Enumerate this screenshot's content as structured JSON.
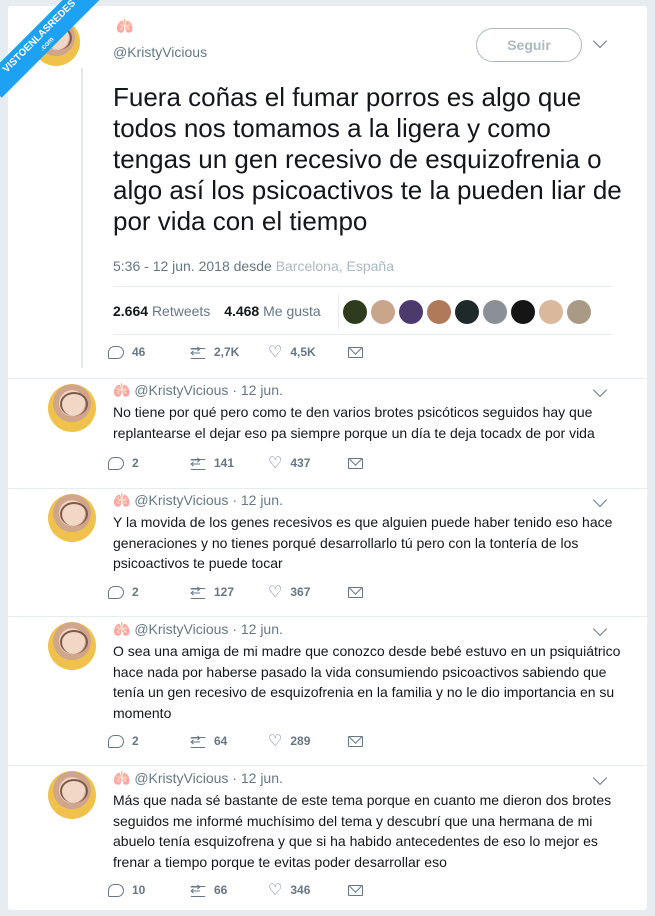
{
  "watermark": {
    "line1": "VISTOENLASREDES",
    "line2": ".com"
  },
  "main_tweet": {
    "handle": "@KristyVicious",
    "emoji": "🫁",
    "follow_label": "Seguir",
    "text": "Fuera coñas el fumar porros es algo que todos nos tomamos a la ligera y como tengas un gen recesivo de esquizofrenia o algo así los psicoactivos te la pueden liar de por vida con el tiempo",
    "time": "5:36 - 12 jun. 2018 desde ",
    "location": "Barcelona, España",
    "retweets_count": "2.664",
    "retweets_label": "Retweets",
    "likes_count": "4.468",
    "likes_label": "Me gusta",
    "replies": "46",
    "rts": "2,7K",
    "favs": "4,5K"
  },
  "replies": [
    {
      "handle": "@KristyVicious",
      "date": "· 12 jun.",
      "text": "No tiene por qué pero como te den varios brotes psicóticos seguidos hay que replantearse el dejar eso pa siempre porque un día te deja tocadx de por vida",
      "replies": "2",
      "rts": "141",
      "favs": "437"
    },
    {
      "handle": "@KristyVicious",
      "date": "· 12 jun.",
      "text": "Y la movida de los genes recesivos es que alguien puede haber tenido eso hace generaciones y no tienes porqué desarrollarlo tú pero con la tontería de los psicoactivos te puede tocar",
      "replies": "2",
      "rts": "127",
      "favs": "367"
    },
    {
      "handle": "@KristyVicious",
      "date": "· 12 jun.",
      "text": "O sea una amiga de mi madre que conozco desde bebé estuvo en un psiquiátrico hace nada por haberse pasado la vida consumiendo psicoactivos sabiendo que tenía un gen recesivo de esquizofrenia en la familia y no le dio importancia en su momento",
      "replies": "2",
      "rts": "64",
      "favs": "289"
    },
    {
      "handle": "@KristyVicious",
      "date": "· 12 jun.",
      "text": "Más que nada sé bastante de este tema porque en cuanto me dieron dos brotes seguidos me informé muchísimo del tema y descubrí que una hermana de mi abuelo tenía esquizofrena y que si ha habido antecedentes de eso lo mejor es frenar a tiempo porque te evitas poder desarrollar eso",
      "replies": "10",
      "rts": "66",
      "favs": "346"
    }
  ],
  "colors": {
    "accent": "#1da1f2",
    "text": "#14171a",
    "muted": "#657786",
    "lungs": "#e0533f"
  }
}
